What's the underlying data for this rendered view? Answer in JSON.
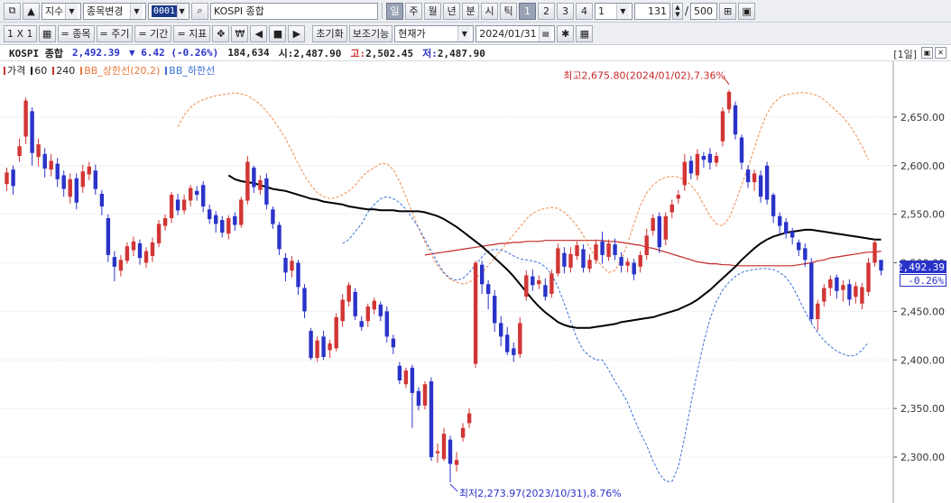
{
  "toolbar1": {
    "market_type": "지수",
    "change_symbol_label": "종목변경",
    "symbol_code": "0001",
    "symbol_name": "KOSPI 종합",
    "periods": [
      "일",
      "주",
      "월",
      "년",
      "분",
      "시",
      "틱"
    ],
    "numbers": [
      "1",
      "2",
      "3",
      "4"
    ],
    "interval_value": "1",
    "display_count": "131",
    "max_count": "500",
    "slash": "/"
  },
  "toolbar2": {
    "layout_label": "1 X 1",
    "symbol_btn": "= 종목",
    "period_btn": "= 주기",
    "range_btn": "= 기간",
    "indicator_btn": "= 지표",
    "reset_btn": "초기화",
    "aux_btn": "보조기능",
    "price_mode": "현재가",
    "date": "2024/01/31"
  },
  "info": {
    "name": "KOSPI 종합",
    "price": "2,492.39",
    "change": "▼ 6.42 (-0.26%)",
    "volume": "184,634",
    "open_label": "시:",
    "open": "2,487.90",
    "high_label": "고:",
    "high": "2,502.45",
    "low_label": "저:",
    "low": "2,487.90",
    "period_label": "[1일]"
  },
  "legend": [
    {
      "name": "가격",
      "color": "#c83232"
    },
    {
      "name": "60",
      "color": "#111111"
    },
    {
      "name": "240",
      "color": "#c83232"
    },
    {
      "name": "BB_상한선(20,2)",
      "color": "#e87a3a"
    },
    {
      "name": "BB_하한선",
      "color": "#3a6fd8"
    }
  ],
  "colors": {
    "up": "#d23535",
    "down": "#2a33c9",
    "ma60": "#000000",
    "ma240": "#c62828",
    "bb_upper": "#f08a4b",
    "bb_lower": "#3a6fd8"
  },
  "chart_data": {
    "type": "candlestick",
    "y_ticks": [
      "2,650.00",
      "2,600.00",
      "2,550.00",
      "2,500.00",
      "2,450.00",
      "2,400.00",
      "2,350.00",
      "2,300.00"
    ],
    "y_tick_values": [
      2650,
      2600,
      2550,
      2500,
      2450,
      2400,
      2350,
      2300
    ],
    "ylim": [
      2262,
      2700
    ],
    "current_price_label": "2,492.39",
    "current_change_label": "-0.26%",
    "annotations": {
      "high": "최고2,675.80(2024/01/02),7.36%",
      "low": "최저2,273.97(2023/10/31),8.76%"
    },
    "candles": [
      [
        2581,
        2593,
        2574,
        2598
      ],
      [
        2596,
        2579,
        2570,
        2600
      ],
      [
        2610,
        2620,
        2604,
        2628
      ],
      [
        2630,
        2667,
        2622,
        2670
      ],
      [
        2656,
        2613,
        2600,
        2660
      ],
      [
        2609,
        2622,
        2599,
        2628
      ],
      [
        2612,
        2597,
        2588,
        2618
      ],
      [
        2596,
        2605,
        2589,
        2612
      ],
      [
        2602,
        2586,
        2578,
        2608
      ],
      [
        2590,
        2576,
        2568,
        2595
      ],
      [
        2568,
        2586,
        2561,
        2592
      ],
      [
        2587,
        2562,
        2555,
        2592
      ],
      [
        2578,
        2594,
        2572,
        2601
      ],
      [
        2591,
        2599,
        2585,
        2604
      ],
      [
        2595,
        2576,
        2570,
        2601
      ],
      [
        2571,
        2558,
        2549,
        2575
      ],
      [
        2546,
        2508,
        2501,
        2550
      ],
      [
        2506,
        2496,
        2481,
        2512
      ],
      [
        2492,
        2503,
        2486,
        2508
      ],
      [
        2502,
        2517,
        2499,
        2521
      ],
      [
        2513,
        2522,
        2507,
        2527
      ],
      [
        2520,
        2505,
        2498,
        2524
      ],
      [
        2500,
        2512,
        2495,
        2516
      ],
      [
        2507,
        2521,
        2501,
        2526
      ],
      [
        2520,
        2540,
        2516,
        2544
      ],
      [
        2538,
        2546,
        2533,
        2550
      ],
      [
        2546,
        2570,
        2541,
        2573
      ],
      [
        2565,
        2554,
        2549,
        2571
      ],
      [
        2554,
        2565,
        2550,
        2570
      ],
      [
        2564,
        2577,
        2558,
        2580
      ],
      [
        2574,
        2570,
        2564,
        2579
      ],
      [
        2580,
        2558,
        2552,
        2584
      ],
      [
        2555,
        2545,
        2540,
        2560
      ],
      [
        2549,
        2540,
        2531,
        2553
      ],
      [
        2544,
        2531,
        2526,
        2548
      ],
      [
        2530,
        2546,
        2524,
        2549
      ],
      [
        2548,
        2539,
        2533,
        2552
      ],
      [
        2539,
        2565,
        2536,
        2568
      ],
      [
        2564,
        2604,
        2560,
        2610
      ],
      [
        2598,
        2578,
        2572,
        2600
      ],
      [
        2575,
        2585,
        2570,
        2590
      ],
      [
        2587,
        2560,
        2555,
        2592
      ],
      [
        2555,
        2540,
        2535,
        2558
      ],
      [
        2539,
        2514,
        2508,
        2542
      ],
      [
        2505,
        2490,
        2481,
        2510
      ],
      [
        2492,
        2502,
        2485,
        2507
      ],
      [
        2500,
        2475,
        2467,
        2503
      ],
      [
        2474,
        2450,
        2443,
        2478
      ],
      [
        2430,
        2402,
        2400,
        2433
      ],
      [
        2402,
        2420,
        2398,
        2424
      ],
      [
        2424,
        2403,
        2400,
        2430
      ],
      [
        2410,
        2417,
        2402,
        2421
      ],
      [
        2412,
        2444,
        2409,
        2448
      ],
      [
        2440,
        2462,
        2434,
        2468
      ],
      [
        2460,
        2477,
        2455,
        2480
      ],
      [
        2470,
        2445,
        2441,
        2474
      ],
      [
        2440,
        2434,
        2430,
        2445
      ],
      [
        2440,
        2455,
        2434,
        2458
      ],
      [
        2452,
        2461,
        2447,
        2464
      ],
      [
        2457,
        2445,
        2440,
        2460
      ],
      [
        2450,
        2424,
        2418,
        2455
      ],
      [
        2422,
        2413,
        2406,
        2426
      ],
      [
        2394,
        2379,
        2375,
        2398
      ],
      [
        2375,
        2389,
        2371,
        2392
      ],
      [
        2392,
        2366,
        2330,
        2395
      ],
      [
        2368,
        2353,
        2348,
        2372
      ],
      [
        2353,
        2375,
        2349,
        2378
      ],
      [
        2378,
        2300,
        2296,
        2382
      ],
      [
        2304,
        2306,
        2294,
        2314
      ],
      [
        2298,
        2324,
        2296,
        2330
      ],
      [
        2318,
        2293,
        2274,
        2322
      ],
      [
        2292,
        2297,
        2285,
        2305
      ],
      [
        2320,
        2330,
        2316,
        2335
      ],
      [
        2335,
        2345,
        2330,
        2350
      ],
      [
        2396,
        2500,
        2392,
        2502
      ],
      [
        2498,
        2478,
        2468,
        2502
      ],
      [
        2478,
        2468,
        2452,
        2482
      ],
      [
        2466,
        2438,
        2429,
        2472
      ],
      [
        2438,
        2424,
        2414,
        2445
      ],
      [
        2426,
        2408,
        2405,
        2434
      ],
      [
        2412,
        2405,
        2398,
        2418
      ],
      [
        2406,
        2438,
        2402,
        2444
      ],
      [
        2465,
        2487,
        2461,
        2492
      ],
      [
        2486,
        2477,
        2471,
        2493
      ],
      [
        2478,
        2482,
        2473,
        2487
      ],
      [
        2477,
        2465,
        2461,
        2484
      ],
      [
        2468,
        2489,
        2464,
        2493
      ],
      [
        2489,
        2515,
        2486,
        2520
      ],
      [
        2510,
        2496,
        2489,
        2516
      ],
      [
        2495,
        2509,
        2490,
        2516
      ],
      [
        2507,
        2518,
        2503,
        2522
      ],
      [
        2514,
        2495,
        2490,
        2519
      ],
      [
        2494,
        2503,
        2490,
        2509
      ],
      [
        2503,
        2519,
        2499,
        2524
      ],
      [
        2522,
        2508,
        2499,
        2532
      ],
      [
        2506,
        2520,
        2502,
        2524
      ],
      [
        2519,
        2508,
        2503,
        2525
      ],
      [
        2506,
        2497,
        2490,
        2511
      ],
      [
        2497,
        2501,
        2490,
        2505
      ],
      [
        2500,
        2488,
        2482,
        2504
      ],
      [
        2496,
        2508,
        2490,
        2512
      ],
      [
        2508,
        2528,
        2503,
        2535
      ],
      [
        2533,
        2546,
        2528,
        2550
      ],
      [
        2548,
        2516,
        2510,
        2552
      ],
      [
        2524,
        2548,
        2518,
        2552
      ],
      [
        2552,
        2560,
        2546,
        2565
      ],
      [
        2566,
        2570,
        2561,
        2575
      ],
      [
        2580,
        2604,
        2574,
        2612
      ],
      [
        2605,
        2592,
        2586,
        2610
      ],
      [
        2590,
        2612,
        2585,
        2617
      ],
      [
        2610,
        2606,
        2598,
        2614
      ],
      [
        2612,
        2603,
        2596,
        2618
      ],
      [
        2603,
        2610,
        2599,
        2614
      ],
      [
        2625,
        2656,
        2620,
        2660
      ],
      [
        2658,
        2676,
        2654,
        2678
      ],
      [
        2662,
        2632,
        2627,
        2666
      ],
      [
        2629,
        2603,
        2596,
        2632
      ],
      [
        2596,
        2583,
        2577,
        2600
      ],
      [
        2583,
        2592,
        2574,
        2596
      ],
      [
        2590,
        2568,
        2562,
        2595
      ],
      [
        2600,
        2565,
        2560,
        2604
      ],
      [
        2570,
        2548,
        2541,
        2572
      ],
      [
        2548,
        2538,
        2530,
        2552
      ],
      [
        2542,
        2530,
        2525,
        2546
      ],
      [
        2532,
        2526,
        2519,
        2536
      ],
      [
        2521,
        2513,
        2507,
        2524
      ],
      [
        2515,
        2503,
        2496,
        2520
      ],
      [
        2500,
        2442,
        2438,
        2505
      ],
      [
        2442,
        2458,
        2430,
        2462
      ],
      [
        2460,
        2474,
        2455,
        2478
      ],
      [
        2474,
        2483,
        2466,
        2487
      ],
      [
        2485,
        2471,
        2463,
        2488
      ],
      [
        2472,
        2477,
        2460,
        2482
      ],
      [
        2478,
        2462,
        2456,
        2483
      ],
      [
        2465,
        2476,
        2458,
        2480
      ],
      [
        2458,
        2475,
        2452,
        2479
      ],
      [
        2470,
        2500,
        2466,
        2505
      ],
      [
        2500,
        2521,
        2496,
        2524
      ],
      [
        2503,
        2492,
        2487,
        2502
      ]
    ],
    "ma60": [
      2590,
      2586,
      2584,
      2583,
      2582,
      2580,
      2578,
      2576,
      2575,
      2574,
      2572,
      2570,
      2568,
      2566,
      2565,
      2563,
      2562,
      2561,
      2560,
      2558,
      2557,
      2556,
      2555,
      2555,
      2554,
      2554,
      2554,
      2553,
      2553,
      2553,
      2553,
      2552,
      2550,
      2548,
      2545,
      2541,
      2537,
      2532,
      2527,
      2522,
      2517,
      2511,
      2505,
      2499,
      2493,
      2486,
      2478,
      2470,
      2462,
      2455,
      2449,
      2444,
      2439,
      2436,
      2434,
      2433,
      2433,
      2433,
      2434,
      2435,
      2436,
      2437,
      2439,
      2440,
      2441,
      2442,
      2443,
      2444,
      2446,
      2448,
      2450,
      2452,
      2455,
      2458,
      2462,
      2467,
      2472,
      2478,
      2484,
      2490,
      2496,
      2503,
      2509,
      2515,
      2520,
      2524,
      2527,
      2529,
      2531,
      2532,
      2533,
      2534,
      2534,
      2533,
      2532,
      2531,
      2530,
      2529,
      2528,
      2527,
      2526,
      2525,
      2524,
      2524
    ],
    "ma240": [
      2508,
      2509,
      2510,
      2511,
      2512,
      2513,
      2514,
      2515,
      2516,
      2517,
      2518,
      2519,
      2520,
      2520,
      2521,
      2521,
      2522,
      2522,
      2522,
      2523,
      2523,
      2523,
      2523,
      2523,
      2523,
      2523,
      2523,
      2523,
      2523,
      2522,
      2522,
      2521,
      2520,
      2519,
      2518,
      2516,
      2515,
      2513,
      2511,
      2509,
      2507,
      2505,
      2503,
      2501,
      2500,
      2499,
      2499,
      2498,
      2498,
      2497,
      2497,
      2497,
      2497,
      2497,
      2497,
      2497,
      2497,
      2497,
      2497,
      2498,
      2499,
      2500,
      2502,
      2503,
      2505,
      2506,
      2507,
      2508,
      2509,
      2510,
      2511,
      2511,
      2512
    ],
    "bb_upper": [
      2640,
      2652,
      2660,
      2665,
      2668,
      2670,
      2672,
      2673,
      2674,
      2675,
      2674,
      2672,
      2668,
      2663,
      2656,
      2648,
      2638,
      2628,
      2615,
      2602,
      2590,
      2580,
      2572,
      2568,
      2566,
      2567,
      2570,
      2574,
      2580,
      2588,
      2594,
      2598,
      2602,
      2602,
      2596,
      2584,
      2568,
      2552,
      2536,
      2521,
      2508,
      2497,
      2489,
      2483,
      2480,
      2478,
      2480,
      2484,
      2490,
      2497,
      2505,
      2513,
      2521,
      2529,
      2537,
      2545,
      2551,
      2554,
      2556,
      2557,
      2556,
      2552,
      2546,
      2538,
      2528,
      2516,
      2504,
      2496,
      2490,
      2492,
      2503,
      2520,
      2540,
      2559,
      2572,
      2580,
      2585,
      2588,
      2589,
      2588,
      2585,
      2580,
      2572,
      2560,
      2548,
      2540,
      2538,
      2546,
      2562,
      2580,
      2598,
      2618,
      2638,
      2654,
      2664,
      2670,
      2673,
      2674,
      2675,
      2675,
      2674,
      2672,
      2668,
      2662,
      2656,
      2650,
      2642,
      2632,
      2620,
      2606
    ],
    "bb_lower": [
      2520,
      2524,
      2532,
      2540,
      2552,
      2560,
      2566,
      2568,
      2566,
      2562,
      2555,
      2546,
      2536,
      2524,
      2512,
      2500,
      2490,
      2484,
      2482,
      2484,
      2490,
      2498,
      2506,
      2512,
      2514,
      2513,
      2511,
      2507,
      2504,
      2503,
      2502,
      2500,
      2496,
      2488,
      2475,
      2458,
      2440,
      2422,
      2410,
      2404,
      2400,
      2400,
      2390,
      2378,
      2368,
      2356,
      2340,
      2325,
      2312,
      2296,
      2283,
      2275,
      2275,
      2290,
      2320,
      2355,
      2388,
      2418,
      2442,
      2460,
      2472,
      2480,
      2486,
      2490,
      2492,
      2493,
      2494,
      2494,
      2493,
      2490,
      2485,
      2476,
      2463,
      2450,
      2438,
      2428,
      2420,
      2414,
      2409,
      2406,
      2404,
      2405,
      2410,
      2418
    ]
  }
}
